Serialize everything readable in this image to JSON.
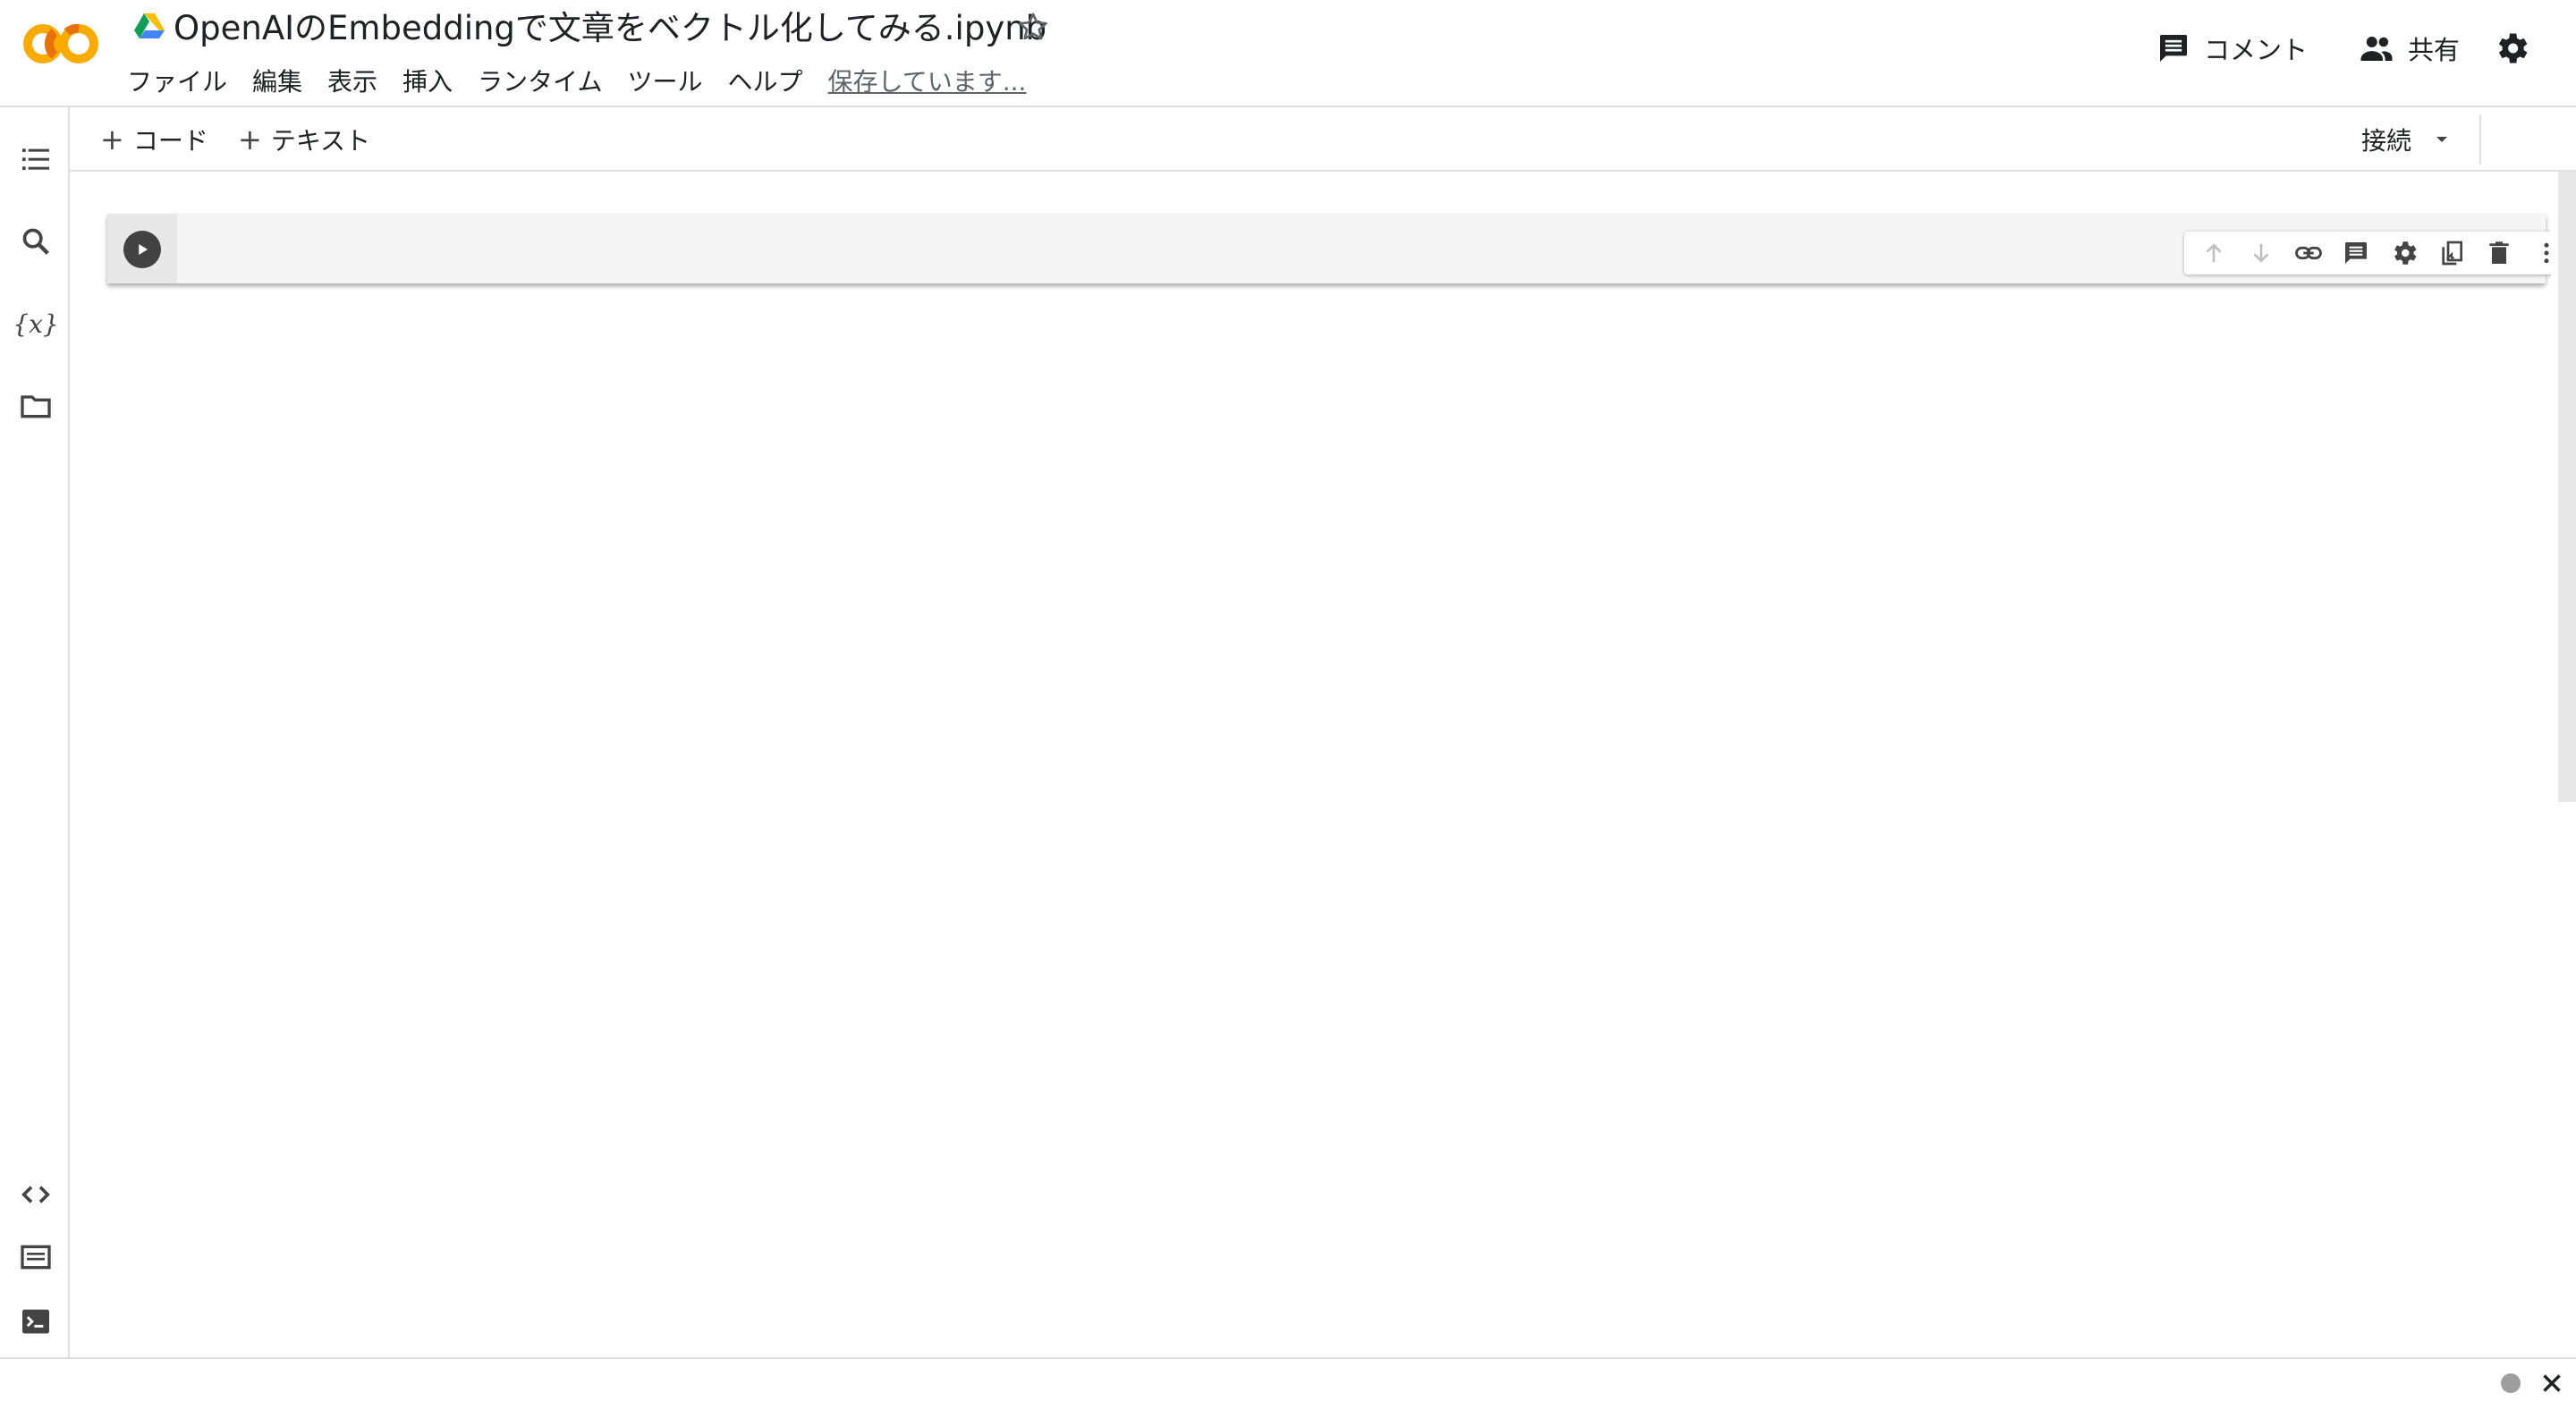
{
  "header": {
    "title": "OpenAIのEmbeddingで文章をベクトル化してみる.ipynb",
    "menu": [
      "ファイル",
      "編集",
      "表示",
      "挿入",
      "ランタイム",
      "ツール",
      "ヘルプ"
    ],
    "save_status": "保存しています...",
    "comment_label": "コメント",
    "share_label": "共有",
    "logo_colors": [
      "#F9AB00",
      "#E8710A"
    ]
  },
  "sidebar": {
    "top_icons": [
      "table-of-contents-icon",
      "search-icon",
      "variables-icon",
      "files-icon"
    ],
    "variables_glyph": "{x}",
    "bottom_icons": [
      "code-snippets-icon",
      "command-palette-icon",
      "terminal-icon"
    ]
  },
  "toolbar": {
    "add_code": "コード",
    "add_text": "テキスト",
    "connect_label": "接続"
  },
  "cell": {
    "toolbar_icons": [
      "move-up-icon",
      "move-down-icon",
      "link-icon",
      "comment-icon",
      "settings-icon",
      "mirror-cell-icon",
      "delete-icon",
      "more-icon"
    ]
  }
}
